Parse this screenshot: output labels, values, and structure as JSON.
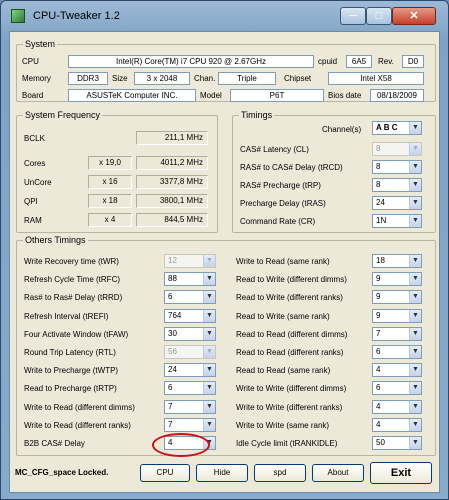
{
  "window": {
    "title": "CPU-Tweaker 1.2"
  },
  "system": {
    "legend": "System",
    "cpu_label": "CPU",
    "cpu_value": "Intel(R) Core(TM) i7 CPU      920  @ 2.67GHz",
    "cpuid_label": "cpuid",
    "cpuid_value": "6A5",
    "rev_label": "Rev.",
    "rev_value": "D0",
    "memory_label": "Memory",
    "memory_value": "DDR3",
    "size_label": "Size",
    "size_value": "3 x 2048",
    "chan_label": "Chan.",
    "chan_value": "Triple",
    "chipset_label": "Chipset",
    "chipset_value": "Intel X58",
    "board_label": "Board",
    "board_value": "ASUSTeK Computer INC.",
    "model_label": "Model",
    "model_value": "P6T",
    "bios_label": "Bios date",
    "bios_value": "08/18/2009"
  },
  "freq": {
    "legend": "System Frequency",
    "bclk_label": "BCLK",
    "bclk_value": "211,1 MHz",
    "rows": [
      {
        "label": "Cores",
        "mult": "x 19,0",
        "value": "4011,2 MHz"
      },
      {
        "label": "UnCore",
        "mult": "x 16",
        "value": "3377,8 MHz"
      },
      {
        "label": "QPI",
        "mult": "x 18",
        "value": "3800,1 MHz"
      },
      {
        "label": "RAM",
        "mult": "x 4",
        "value": "844,5 MHz"
      }
    ]
  },
  "timings": {
    "legend": "Timings",
    "channel_label": "Channel(s)",
    "channel_value": "A B C",
    "rows": [
      {
        "label": "CAS# Latency (CL)",
        "value": "8",
        "disabled": true
      },
      {
        "label": "RAS# to CAS# Delay (tRCD)",
        "value": "8",
        "disabled": false
      },
      {
        "label": "RAS# Precharge (tRP)",
        "value": "8",
        "disabled": false
      },
      {
        "label": "Precharge Delay (tRAS)",
        "value": "24",
        "disabled": false
      },
      {
        "label": "Command Rate (CR)",
        "value": "1N",
        "disabled": false
      }
    ]
  },
  "others": {
    "legend": "Others Timings",
    "left": [
      {
        "label": "Write Recovery time (tWR)",
        "value": "12",
        "disabled": true
      },
      {
        "label": "Refresh Cycle Time (tRFC)",
        "value": "88",
        "disabled": false
      },
      {
        "label": "Ras# to Ras# Delay (tRRD)",
        "value": "6",
        "disabled": false
      },
      {
        "label": "Refresh Interval (tREFI)",
        "value": "764",
        "disabled": false
      },
      {
        "label": "Four Activate Window (tFAW)",
        "value": "30",
        "disabled": false
      },
      {
        "label": "Round Trip Latency (RTL)",
        "value": "56",
        "disabled": true
      },
      {
        "label": "Write to Precharge (tWTP)",
        "value": "24",
        "disabled": false
      },
      {
        "label": "Read to Precharge (tRTP)",
        "value": "6",
        "disabled": false
      },
      {
        "label": "Write to Read (different dimms)",
        "value": "7",
        "disabled": false
      },
      {
        "label": "Write to Read (different ranks)",
        "value": "7",
        "disabled": false
      },
      {
        "label": "B2B CAS# Delay",
        "value": "4",
        "disabled": false
      }
    ],
    "right": [
      {
        "label": "Write to Read (same rank)",
        "value": "18"
      },
      {
        "label": "Read to Write (different dimms)",
        "value": "9"
      },
      {
        "label": "Read to Write (different ranks)",
        "value": "9"
      },
      {
        "label": "Read to Write (same rank)",
        "value": "9"
      },
      {
        "label": "Read to Read (different dimms)",
        "value": "7"
      },
      {
        "label": "Read to Read (different ranks)",
        "value": "6"
      },
      {
        "label": "Read to Read (same rank)",
        "value": "4"
      },
      {
        "label": "Write to Write (different dimms)",
        "value": "6"
      },
      {
        "label": "Write to Write (different ranks)",
        "value": "4"
      },
      {
        "label": "Write to Write (same rank)",
        "value": "4"
      },
      {
        "label": "Idle Cycle limit (tRANKIDLE)",
        "value": "50"
      }
    ]
  },
  "footer": {
    "status": "MC_CFG_space Locked.",
    "cpu_button": "CPU",
    "hide_button": "Hide",
    "spd_button": "spd",
    "about_button": "About",
    "exit_button": "Exit"
  },
  "colors": {
    "highlight": "#d01010"
  }
}
